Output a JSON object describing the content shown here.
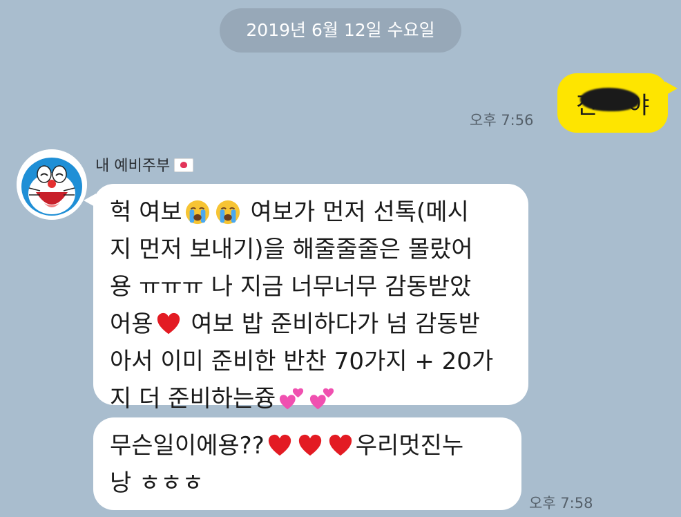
{
  "date_divider": "2019년 6월 12일 수요일",
  "outgoing": {
    "time": "오후 7:56",
    "text_visible": "진",
    "text_suffix": "야",
    "bubble_color": "#fee500",
    "redaction": "blacked-out scribble over part of text"
  },
  "incoming": {
    "sender_name": "내 예비주부",
    "sender_badge_icon": "heart-envelope-icon",
    "avatar_icon": "doraemon-avatar-icon",
    "message1": {
      "lines": [
        {
          "parts": [
            "헉 여보",
            "EMOJI:crying-face-icon",
            "EMOJI:crying-face-icon",
            " 여보가 먼저 선톡(메시"
          ]
        },
        {
          "parts": [
            "지 먼저 보내기)을 해줄줄줄은 몰랐어"
          ]
        },
        {
          "parts": [
            "용 ㅠㅠㅠ 나 지금 너무너무 감동받았"
          ]
        },
        {
          "parts": [
            "어용",
            "EMOJI:red-heart-icon",
            " 여보 밥 준비하다가 넘 감동받"
          ]
        },
        {
          "parts": [
            "아서 이미 준비한 반찬 70가지 + 20가"
          ]
        },
        {
          "parts": [
            "지 더 준비하는즁",
            "EMOJI:two-hearts-icon",
            "EMOJI:two-hearts-icon"
          ]
        }
      ]
    },
    "message2": {
      "lines": [
        {
          "parts": [
            "무슨일이에용??",
            "EMOJI:red-heart-icon",
            "EMOJI:red-heart-icon",
            "EMOJI:red-heart-icon",
            "우리멋진누"
          ]
        },
        {
          "parts": [
            "낭 ㅎㅎㅎ"
          ]
        }
      ],
      "time": "오후 7:58"
    }
  },
  "colors": {
    "background": "#a9bdce",
    "date_pill": "#97a8b8",
    "incoming_bubble": "#ffffff"
  }
}
